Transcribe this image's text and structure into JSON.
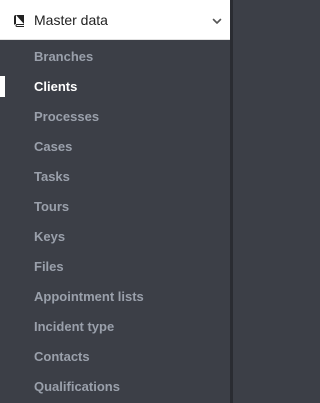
{
  "header": {
    "title": "Master data",
    "icon": "book-icon",
    "toggle_icon": "chevron-down-icon"
  },
  "menu": {
    "items": [
      {
        "label": "Branches",
        "active": false
      },
      {
        "label": "Clients",
        "active": true
      },
      {
        "label": "Processes",
        "active": false
      },
      {
        "label": "Cases",
        "active": false
      },
      {
        "label": "Tasks",
        "active": false
      },
      {
        "label": "Tours",
        "active": false
      },
      {
        "label": "Keys",
        "active": false
      },
      {
        "label": "Files",
        "active": false
      },
      {
        "label": "Appointment lists",
        "active": false
      },
      {
        "label": "Incident type",
        "active": false
      },
      {
        "label": "Contacts",
        "active": false
      },
      {
        "label": "Qualifications",
        "active": false
      }
    ]
  },
  "colors": {
    "sidebar_bg": "#3c3f47",
    "item_text": "#9aa0ab",
    "active_text": "#ffffff",
    "header_bg": "#ffffff"
  }
}
